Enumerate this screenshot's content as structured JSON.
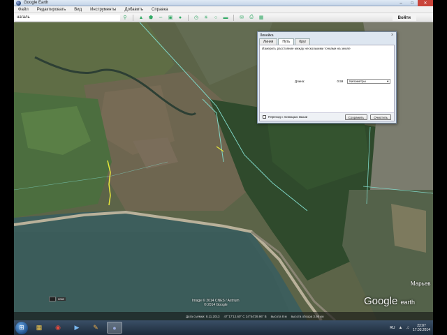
{
  "window": {
    "title": "Google Earth",
    "min_icon": "minimize-icon",
    "max_icon": "maximize-icon",
    "close_icon": "close-icon"
  },
  "menu": [
    "Файл",
    "Редактировать",
    "Вид",
    "Инструменты",
    "Добавить",
    "Справка"
  ],
  "search": {
    "value": "нагаль",
    "button": "Войти"
  },
  "toolbar_icons": [
    "search-icon",
    "placemark-icon",
    "polygon-icon",
    "path-icon",
    "overlay-icon",
    "tour-icon",
    "history-icon",
    "sun-icon",
    "planets-icon",
    "ruler-icon",
    "email-icon",
    "print-icon",
    "maps-icon"
  ],
  "map": {
    "imagery_credit_line1": "Image © 2014 CNES / Astrium",
    "imagery_credit_line2": "© 2014 Google",
    "logo_main": "Google",
    "logo_sub": "earth",
    "place_label": "Марьев",
    "scale_text": "2082",
    "status": {
      "date": "Дата съёмки: 8.11.2013",
      "coords": "47°17'12.60\" С   34°54'39.96\" В",
      "elevation": "высота 8 м",
      "eye_alt": "высота обзора 3.98 км"
    },
    "colors": {
      "water": "#3d5e5c",
      "field": "#6b6650",
      "forest": "#2e4a2c",
      "boundary": "#7fd6c6",
      "path_line": "#e8e83a"
    }
  },
  "ruler_dialog": {
    "title": "Линейка",
    "close": "x",
    "tabs": [
      "Линия",
      "Путь",
      "Круг"
    ],
    "active_tab": 1,
    "description": "Измерить расстояние между несколькими точками на земле",
    "length_label": "Длина:",
    "length_value": "0.59",
    "unit": "Километры",
    "mouse_nav_label": "Переход с помощью мыши",
    "save_button": "Сохранить",
    "clear_button": "Очистить"
  },
  "taskbar": {
    "apps": [
      "explorer-icon",
      "chrome-icon",
      "media-icon",
      "paint-icon",
      "google-earth-icon"
    ],
    "active_app": 4,
    "tray": {
      "lang": "RU",
      "time": "22:07",
      "date": "17.03.2014"
    }
  }
}
